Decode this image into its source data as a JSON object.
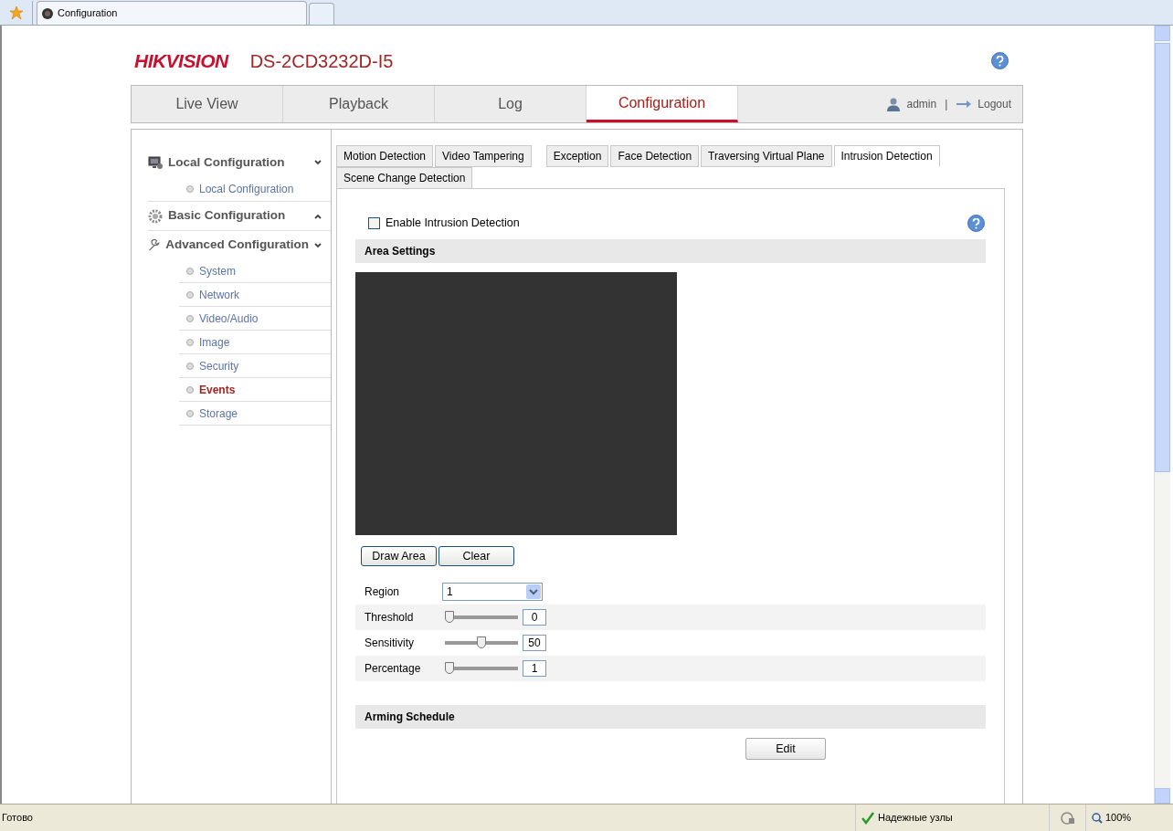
{
  "browser": {
    "tab_title": "Configuration",
    "status_text": "Готово",
    "zone_text": "Надежные узлы",
    "zoom": "100%"
  },
  "header": {
    "logo": "HIKVISION",
    "model": "DS-2CD3232D-I5"
  },
  "nav": [
    {
      "label": "Live View",
      "selected": false
    },
    {
      "label": "Playback",
      "selected": false
    },
    {
      "label": "Log",
      "selected": false
    },
    {
      "label": "Configuration",
      "selected": true
    }
  ],
  "user": {
    "name": "admin",
    "separator": "|",
    "logout": "Logout"
  },
  "sidebar": [
    {
      "label": "Local Configuration",
      "kind": "monitor",
      "expanded": true,
      "children": [
        {
          "label": "Local Configuration",
          "selected": false
        }
      ]
    },
    {
      "label": "Basic Configuration",
      "kind": "gear",
      "expanded": false
    },
    {
      "label": "Advanced Configuration",
      "kind": "wrench",
      "expanded": true,
      "children": [
        {
          "label": "System",
          "selected": false
        },
        {
          "label": "Network",
          "selected": false
        },
        {
          "label": "Video/Audio",
          "selected": false
        },
        {
          "label": "Image",
          "selected": false
        },
        {
          "label": "Security",
          "selected": false
        },
        {
          "label": "Events",
          "selected": true
        },
        {
          "label": "Storage",
          "selected": false
        }
      ]
    }
  ],
  "tabs": [
    {
      "label": "Motion Detection",
      "selected": false
    },
    {
      "label": "Video Tampering",
      "selected": false
    },
    {
      "label": "Exception",
      "selected": false
    },
    {
      "label": "Face Detection",
      "selected": false
    },
    {
      "label": "Traversing Virtual Plane",
      "selected": false
    },
    {
      "label": "Intrusion Detection",
      "selected": true
    },
    {
      "label": "Scene Change Detection",
      "selected": false
    }
  ],
  "enable": {
    "label": "Enable Intrusion Detection",
    "checked": false
  },
  "area_settings": {
    "title": "Area Settings",
    "buttons": [
      "Draw Area",
      "Clear"
    ],
    "region": {
      "label": "Region",
      "value": "1"
    },
    "sliders": [
      {
        "label": "Threshold",
        "level": 0,
        "value": "0"
      },
      {
        "label": "Sensitivity",
        "level": 0.5,
        "value": "50"
      },
      {
        "label": "Percentage",
        "level": 0,
        "value": "1"
      }
    ]
  },
  "arming_schedule": {
    "title": "Arming Schedule",
    "button": "Edit"
  }
}
